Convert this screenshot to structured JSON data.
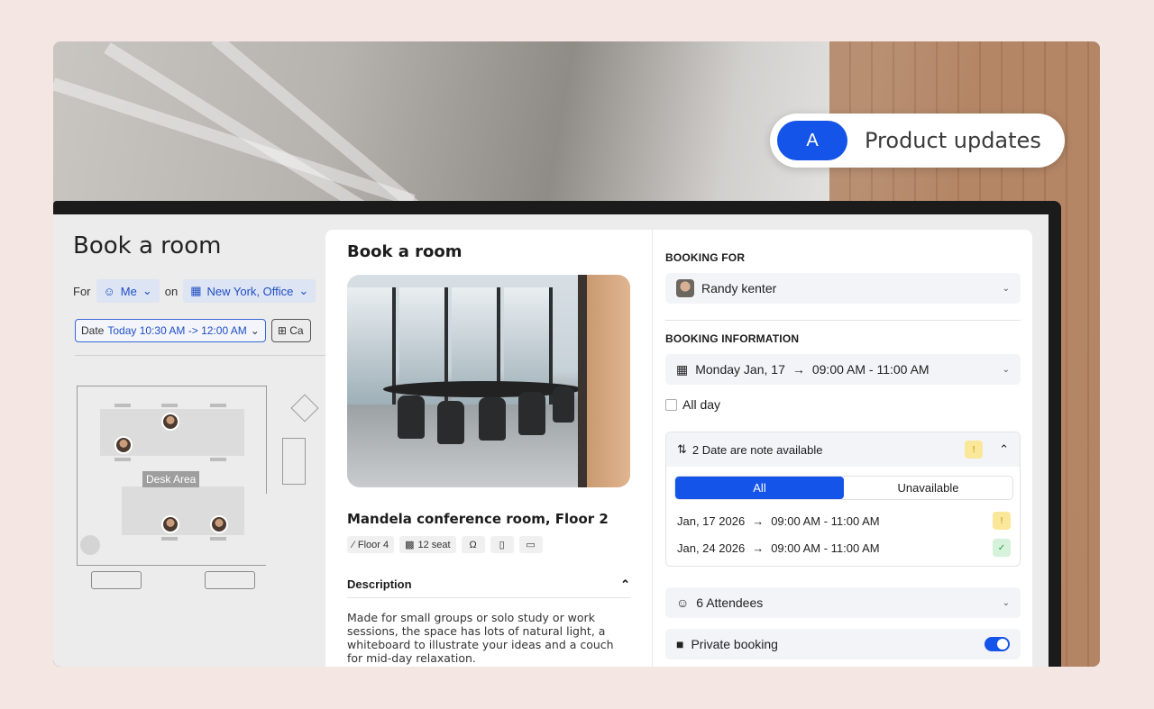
{
  "pill": {
    "badge": "A",
    "text": "Product updates"
  },
  "bg_app": {
    "title": "Book a room",
    "for_label": "For",
    "for_value": "Me",
    "on_label": "on",
    "location": "New York, Office",
    "date_label": "Date",
    "date_value": "Today 10:30 AM -> 12:00 AM",
    "category_label": "Ca",
    "desk_area_label": "Desk Area"
  },
  "room_panel": {
    "title": "Book a room",
    "room_name": "Mandela conference room, Floor 2",
    "floor_tag": "Floor 4",
    "seat_tag": "12 seat",
    "description_title": "Description",
    "description_text": "Made for small groups or solo study or work sessions, the space has lots of natural light, a whiteboard to illustrate your ideas and a couch for mid-day relaxation."
  },
  "booking_panel": {
    "booking_for_label": "BOOKING FOR",
    "booking_for_name": "Randy kenter",
    "booking_info_label": "BOOKING INFORMATION",
    "date_day": "Monday Jan, 17",
    "date_time": "09:00 AM - 11:00 AM",
    "all_day_label": "All day",
    "availability_title": "2 Date are note available",
    "tab_all": "All",
    "tab_unavailable": "Unavailable",
    "rows": [
      {
        "date": "Jan, 17 2026",
        "time": "09:00 AM - 11:00 AM",
        "status": "warning"
      },
      {
        "date": "Jan, 24 2026",
        "time": "09:00 AM - 11:00 AM",
        "status": "ok"
      }
    ],
    "attendees": "6 Attendees",
    "private_label": "Private booking",
    "private_on": true
  },
  "colors": {
    "accent": "#1454e8",
    "background": "#f4e6e3",
    "warning": "#fbe79a",
    "ok": "#d6f2da"
  }
}
